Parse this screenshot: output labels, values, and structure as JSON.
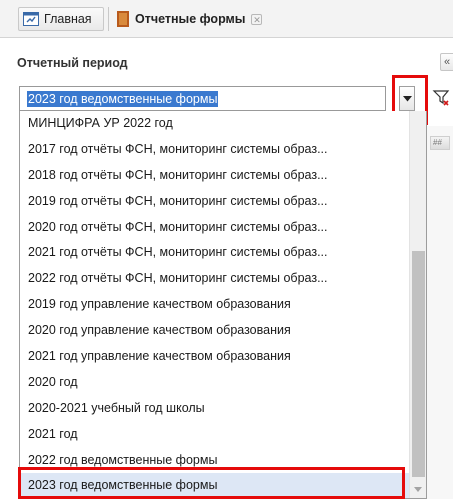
{
  "tabs": [
    {
      "label": "Главная",
      "icon": "home-icon"
    },
    {
      "label": "Отчетные формы",
      "icon": "forms-icon",
      "close": "✕"
    }
  ],
  "panel": {
    "title": "Отчетный период",
    "collapse_label": "«"
  },
  "combo": {
    "value": "2023 год ведомственные формы"
  },
  "dropdown": {
    "items": [
      "МИНЦИФРА УР 2022 год",
      "2017 год отчёты ФСН, мониторинг системы образ...",
      "2018 год отчёты ФСН, мониторинг системы образ...",
      "2019 год отчёты ФСН, мониторинг системы образ...",
      "2020 год отчёты ФСН, мониторинг системы образ...",
      "2021 год отчёты ФСН, мониторинг системы образ...",
      "2022 год отчёты ФСН, мониторинг системы образ...",
      "2019 год управление качеством образования",
      "2020 год управление качеством образования",
      "2021 год управление качеством образования",
      "2020 год",
      "2020-2021 учебный год школы",
      "2021 год",
      "2022 год ведомственные формы",
      "2023 год ведомственные формы"
    ],
    "selected_index": 14
  },
  "colors": {
    "highlight_red": "#e50b0b",
    "selection_blue": "#3a79cf",
    "selected_row": "#dde7f5"
  },
  "side": {
    "mini_label": "##"
  }
}
